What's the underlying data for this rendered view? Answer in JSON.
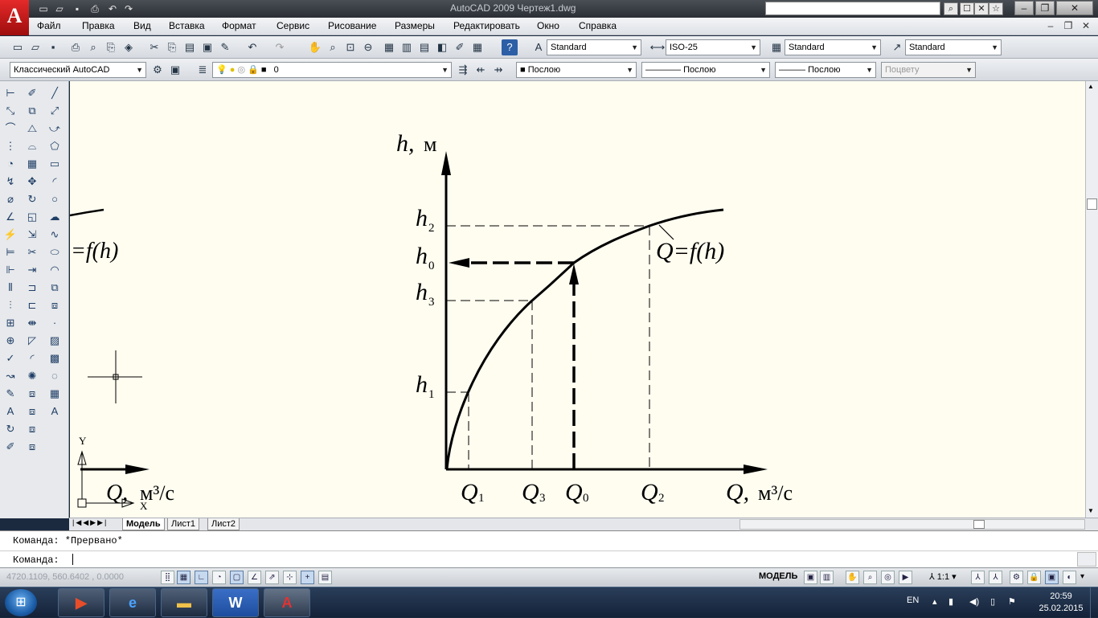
{
  "title_bar": {
    "window_title": "AutoCAD 2009 Чертеж1.dwg",
    "search_placeholder": ""
  },
  "app_logo_letter": "A",
  "menu": {
    "items": [
      "Файл",
      "Правка",
      "Вид",
      "Вставка",
      "Формат",
      "Сервис",
      "Рисование",
      "Размеры",
      "Редактировать",
      "Окно",
      "Справка"
    ]
  },
  "toolbar_styles": {
    "text_style": "Standard",
    "dim_style": "ISO-25",
    "table_style": "Standard",
    "multileader_style": "Standard"
  },
  "toolbar_layers": {
    "workspace": "Классический AutoCAD",
    "layer": "0",
    "color": "Послою",
    "linetype": "Послою",
    "lineweight": "Послою",
    "plotstyle": "Поцвету"
  },
  "drawing": {
    "axis_y_var": "h,",
    "axis_y_unit": "м",
    "axis_x_var": "Q,",
    "axis_x_unit": "м³/с",
    "curve_label": "Q=f(h)",
    "left_curve_label": "=f(h)",
    "left_axis_var": "Q,",
    "left_axis_unit": "м³/с",
    "y_ticks": [
      {
        "base": "h",
        "sub": "2"
      },
      {
        "base": "h",
        "sub": "0"
      },
      {
        "base": "h",
        "sub": "3"
      },
      {
        "base": "h",
        "sub": "1"
      }
    ],
    "x_ticks": [
      {
        "base": "Q",
        "sub": "1"
      },
      {
        "base": "Q",
        "sub": "3"
      },
      {
        "base": "Q",
        "sub": "0"
      },
      {
        "base": "Q",
        "sub": "2"
      }
    ],
    "ucs_y_label": "Y",
    "ucs_x_label": "X"
  },
  "tabs": {
    "model": "Модель",
    "sheet1": "Лист1",
    "sheet2": "Лист2"
  },
  "command": {
    "history": "Команда:  *Прервано*",
    "prompt": "Команда:"
  },
  "status": {
    "coords": "4720.1109, 560.6402 , 0.0000",
    "model_label": "МОДЕЛЬ",
    "scale": "1:1"
  },
  "taskbar": {
    "lang": "EN",
    "time": "20:59",
    "date": "25.02.2015"
  }
}
